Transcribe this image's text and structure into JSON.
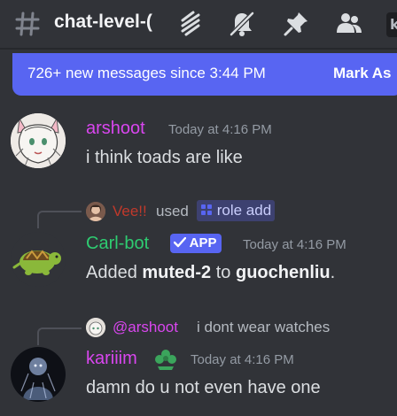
{
  "header": {
    "channel_name": "chat-level-(",
    "search_stub": "k",
    "icons": [
      "threads-icon",
      "mute-bell-icon",
      "pin-icon",
      "members-icon"
    ]
  },
  "new_messages_bar": {
    "text": "726+ new messages since 3:44 PM",
    "action": "Mark As"
  },
  "messages": [
    {
      "author": "arshoot",
      "author_color": "#d946ef",
      "timestamp": "Today at 4:16 PM",
      "text": "i think toads are like"
    },
    {
      "command_user": "Vee!!",
      "command_user_color": "#c0392b",
      "command_verb": "used",
      "command_name": "role add",
      "author": "Carl-bot",
      "author_color": "#2ecc71",
      "app_tag": "APP",
      "timestamp": "Today at 4:16 PM",
      "text_prefix": "Added ",
      "role": "muted-2",
      "text_middle": " to ",
      "target": "guochenliu",
      "text_suffix": "."
    },
    {
      "reply_to": "@arshoot",
      "reply_to_color": "#d946ef",
      "reply_text": "i dont wear watches",
      "author": "kariiim",
      "author_color": "#d946ef",
      "timestamp": "Today at 4:16 PM",
      "text": "damn do u not even have one"
    }
  ]
}
